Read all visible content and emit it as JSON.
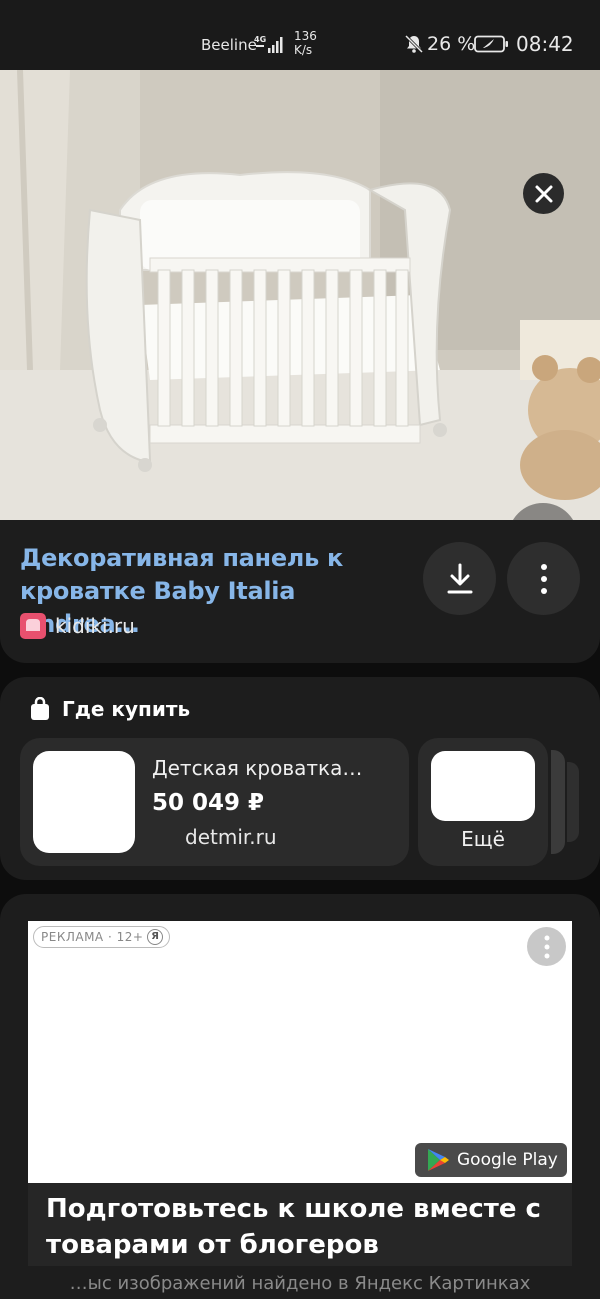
{
  "status_bar": {
    "carrier": "Beeline",
    "network": "4G",
    "speed_value": "136",
    "speed_unit": "K/s",
    "battery_percent": "26 %",
    "time": "08:42"
  },
  "hero": {
    "alt_icon_close": "close-icon",
    "alt_icon_favorite": "heart-icon"
  },
  "result": {
    "title": "Декоративная панель к кроватке Baby Italia Andrea…",
    "source": "kidiki.ru",
    "title_color": "#87b6e8"
  },
  "where_to_buy": {
    "header": "Где купить",
    "offer": {
      "title": "Детская кроватка…",
      "price": "50 049 ₽",
      "shop": "detmir.ru"
    },
    "more_label": "Ещё"
  },
  "ad": {
    "badge_label": "РЕКЛАМА · 12+",
    "badge_logo": "Я",
    "store_label": "Google Play",
    "headline": "Подготовьтесь к школе вместе с товарами от блогеров"
  },
  "footer": {
    "text": "…ыс изображений найдено в Яндекс Картинках"
  }
}
